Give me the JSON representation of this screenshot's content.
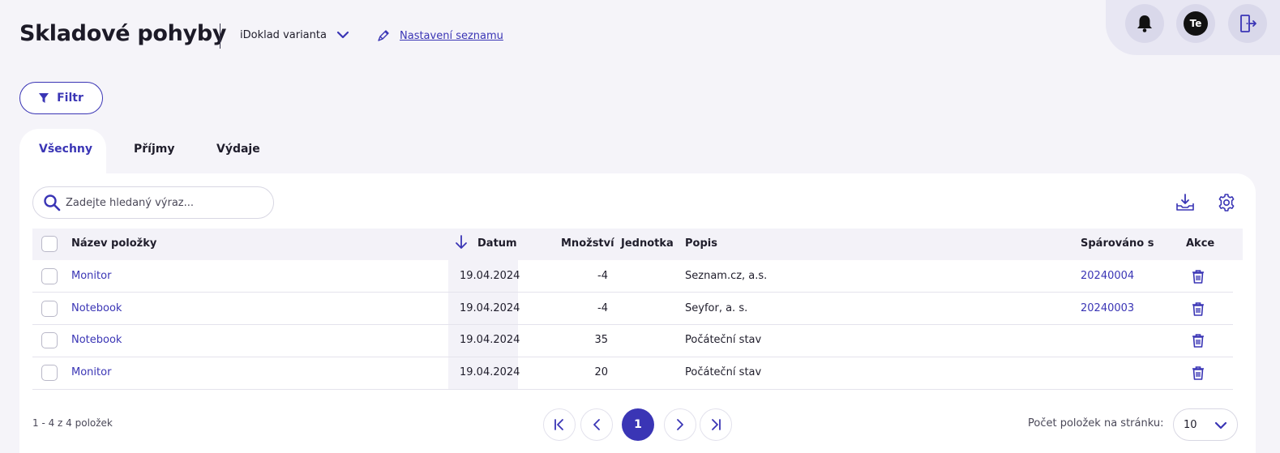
{
  "header": {
    "title": "Skladové pohyby",
    "variant_label": "iDoklad varianta",
    "settings_link": "Nastavení seznamu",
    "avatar_initials": "Te"
  },
  "toolbar": {
    "filter_label": "Filtr"
  },
  "tabs": [
    {
      "label": "Všechny",
      "active": true
    },
    {
      "label": "Příjmy",
      "active": false
    },
    {
      "label": "Výdaje",
      "active": false
    }
  ],
  "search": {
    "placeholder": "Zadejte hledaný výraz..."
  },
  "table": {
    "columns": {
      "name": "Název položky",
      "date": "Datum",
      "quantity": "Množství",
      "unit": "Jednotka",
      "description": "Popis",
      "paired": "Spárováno s",
      "actions": "Akce"
    },
    "rows": [
      {
        "name": "Monitor",
        "date": "19.04.2024",
        "quantity": "-4",
        "unit": "",
        "description": "Seznam.cz, a.s.",
        "paired": "20240004"
      },
      {
        "name": "Notebook",
        "date": "19.04.2024",
        "quantity": "-4",
        "unit": "",
        "description": "Seyfor, a. s.",
        "paired": "20240003"
      },
      {
        "name": "Notebook",
        "date": "19.04.2024",
        "quantity": "35",
        "unit": "",
        "description": "Počáteční stav",
        "paired": ""
      },
      {
        "name": "Monitor",
        "date": "19.04.2024",
        "quantity": "20",
        "unit": "",
        "description": "Počáteční stav",
        "paired": ""
      }
    ]
  },
  "footer": {
    "count_text": "1 - 4 z 4 položek",
    "current_page": "1",
    "per_page_label": "Počet položek na stránku:",
    "per_page_value": "10"
  },
  "colors": {
    "accent": "#3a35b5",
    "background": "#f5f4f9"
  },
  "icons": [
    "bell-icon",
    "logout-icon",
    "filter-icon",
    "search-icon",
    "download-icon",
    "gear-icon",
    "trash-icon",
    "sort-down-icon",
    "pencil-icon",
    "chevron-down-icon"
  ]
}
